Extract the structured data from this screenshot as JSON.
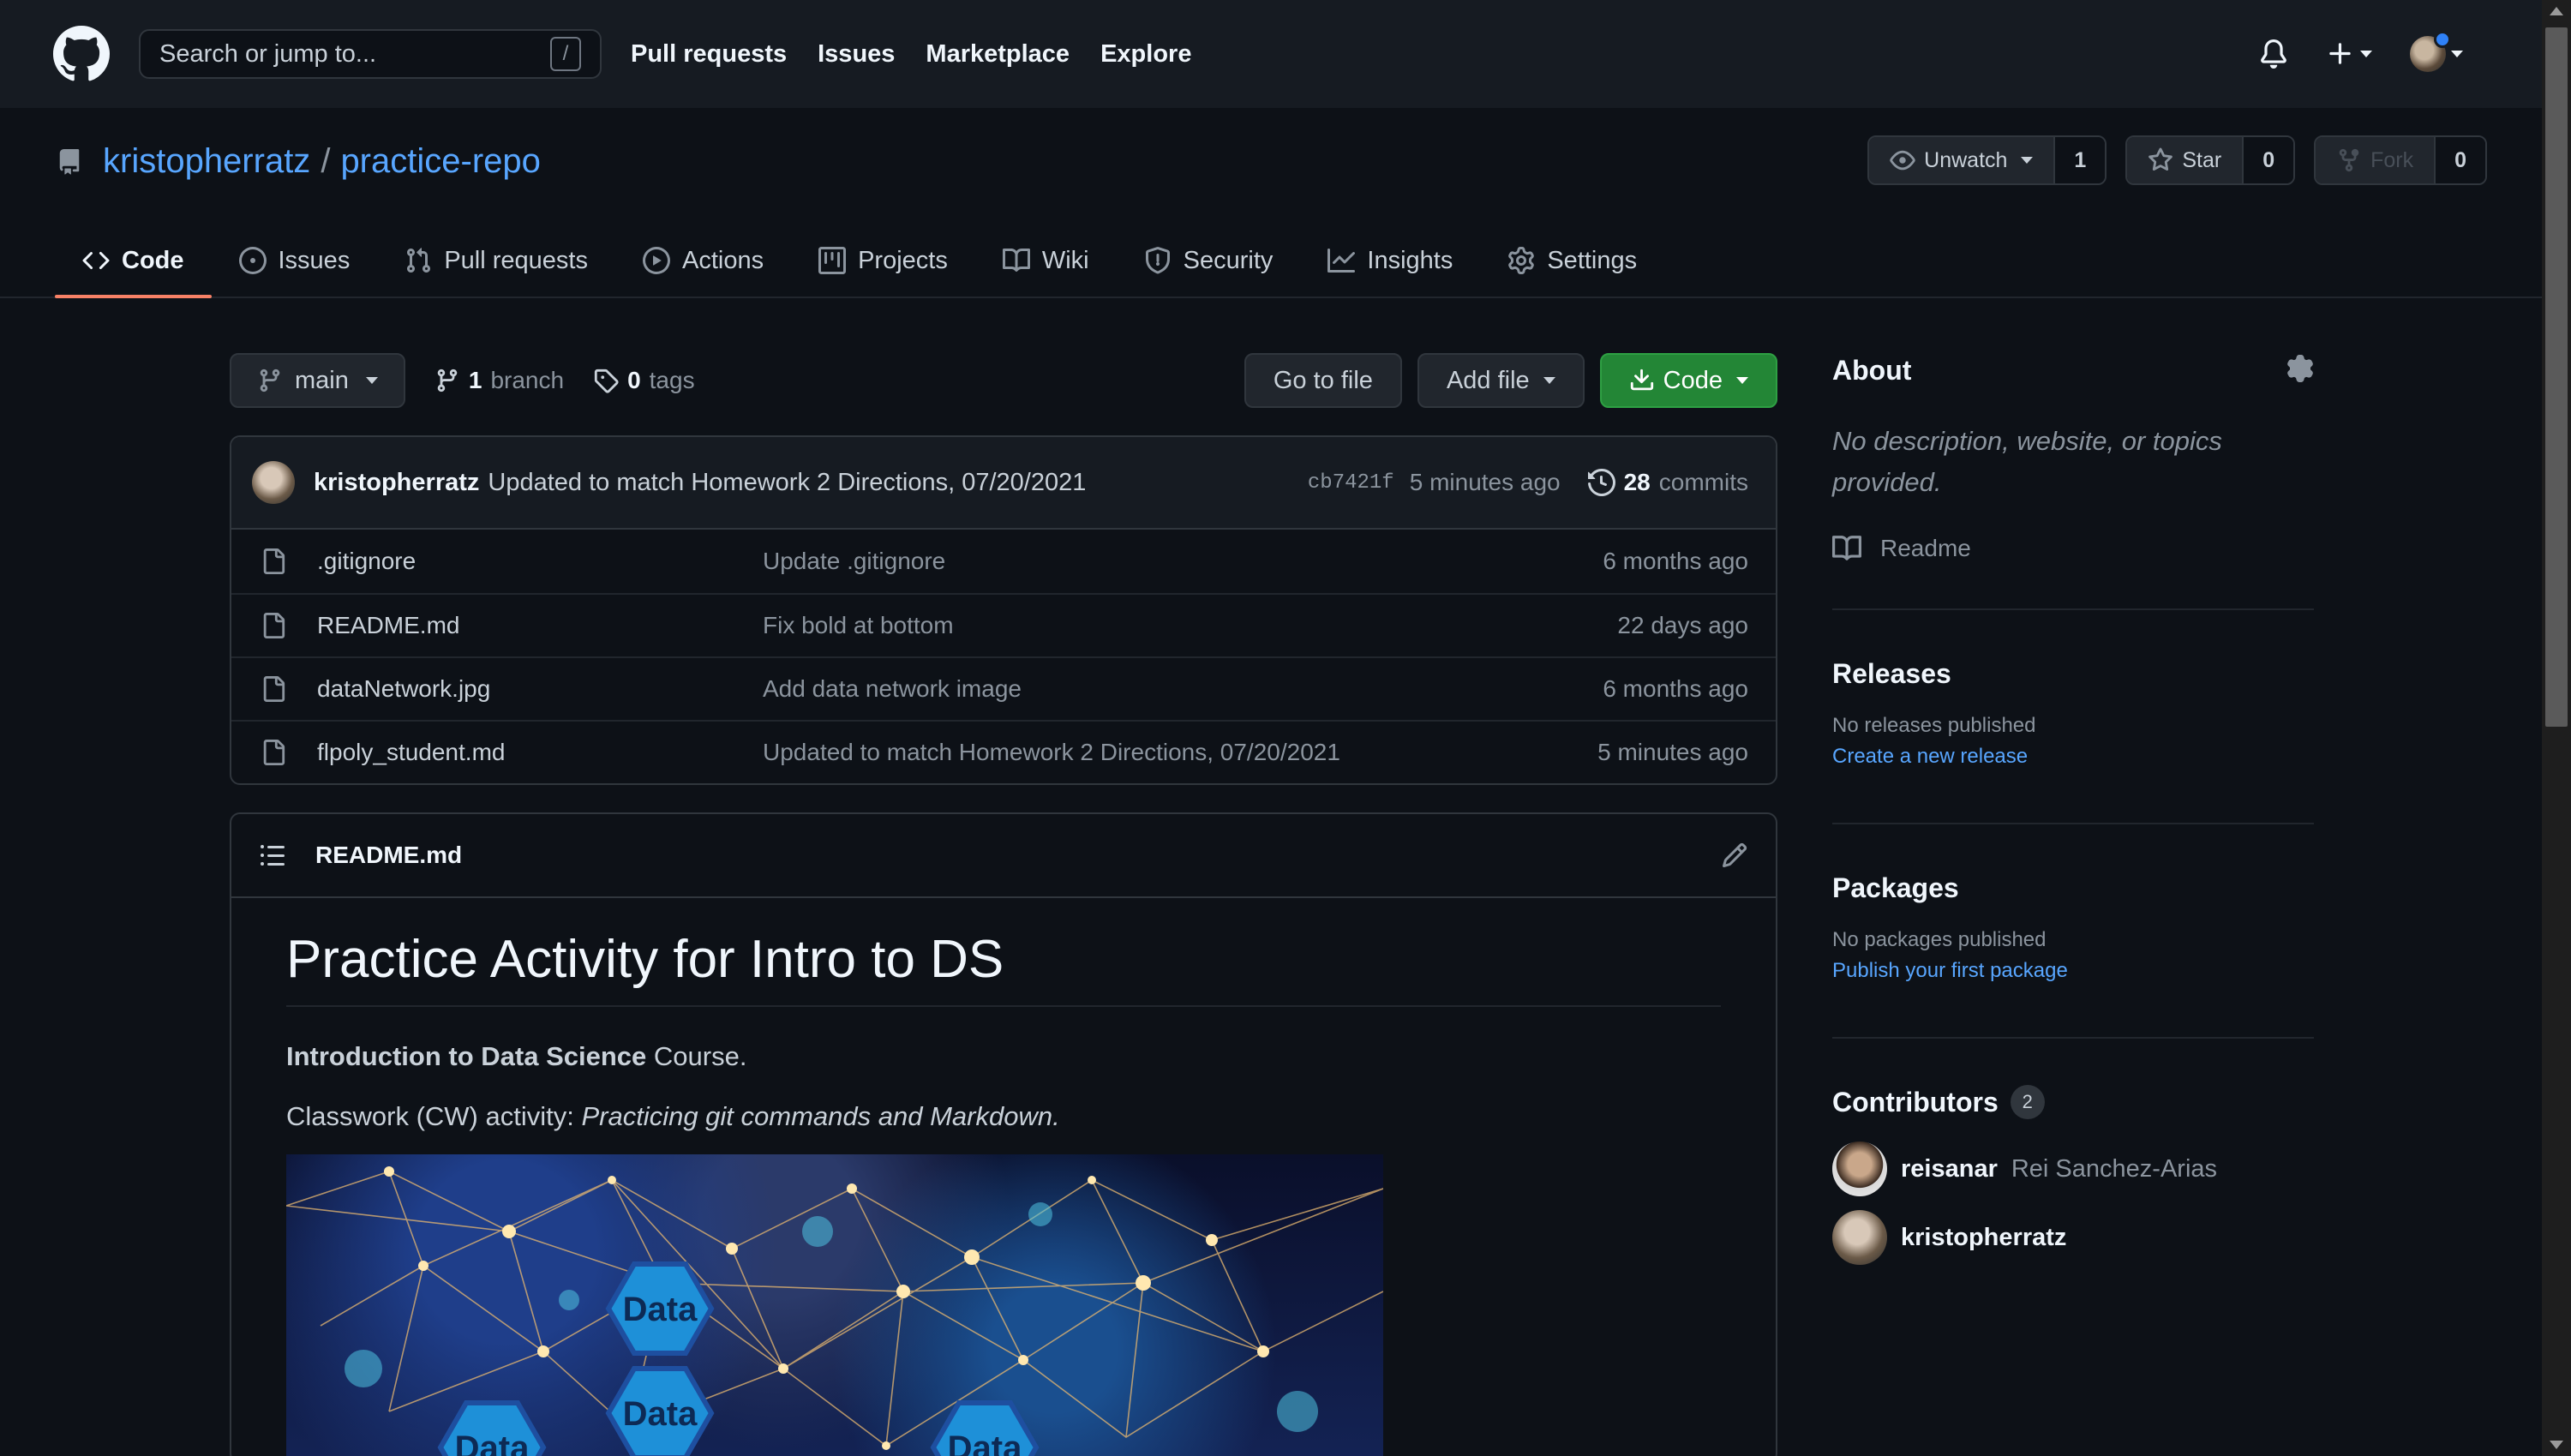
{
  "header": {
    "search_placeholder": "Search or jump to...",
    "search_shortcut": "/",
    "nav": [
      "Pull requests",
      "Issues",
      "Marketplace",
      "Explore"
    ],
    "icons": [
      "github-logo",
      "bell-icon",
      "plus-icon",
      "avatar"
    ]
  },
  "repo": {
    "owner": "kristopherratz",
    "separator": "/",
    "name": "practice-repo",
    "actions": {
      "watch_label": "Unwatch",
      "watch_count": "1",
      "star_label": "Star",
      "star_count": "0",
      "fork_label": "Fork",
      "fork_count": "0"
    },
    "tabs": [
      {
        "label": "Code",
        "icon": "code-icon",
        "active": true
      },
      {
        "label": "Issues",
        "icon": "issue-icon"
      },
      {
        "label": "Pull requests",
        "icon": "pull-request-icon"
      },
      {
        "label": "Actions",
        "icon": "play-icon"
      },
      {
        "label": "Projects",
        "icon": "project-icon"
      },
      {
        "label": "Wiki",
        "icon": "book-icon"
      },
      {
        "label": "Security",
        "icon": "shield-icon"
      },
      {
        "label": "Insights",
        "icon": "graph-icon"
      },
      {
        "label": "Settings",
        "icon": "gear-icon"
      }
    ]
  },
  "file_nav": {
    "branch": "main",
    "branch_count": "1",
    "branch_label": "branch",
    "tag_count": "0",
    "tag_label": "tags",
    "go_to_file": "Go to file",
    "add_file": "Add file",
    "code": "Code"
  },
  "commit": {
    "author": "kristopherratz",
    "message": "Updated to match Homework 2 Directions, 07/20/2021",
    "sha": "cb7421f",
    "ago": "5 minutes ago",
    "count": "28",
    "count_label": "commits"
  },
  "files": [
    {
      "name": ".gitignore",
      "message": "Update .gitignore",
      "age": "6 months ago"
    },
    {
      "name": "README.md",
      "message": "Fix bold at bottom",
      "age": "22 days ago"
    },
    {
      "name": "dataNetwork.jpg",
      "message": "Add data network image",
      "age": "6 months ago"
    },
    {
      "name": "flpoly_student.md",
      "message": "Updated to match Homework 2 Directions, 07/20/2021",
      "age": "5 minutes ago"
    }
  ],
  "readme": {
    "filename": "README.md",
    "h1": "Practice Activity for Intro to DS",
    "p1_bold": "Introduction to Data Science",
    "p1_rest": " Course.",
    "p2_prefix": "Classwork (CW) activity: ",
    "p2_em": "Practicing git commands and Markdown.",
    "image_labels": [
      "Data",
      "Data",
      "Data",
      "Data"
    ]
  },
  "sidebar": {
    "about_title": "About",
    "about_desc": "No description, website, or topics provided.",
    "readme_link": "Readme",
    "releases_title": "Releases",
    "releases_empty": "No releases published",
    "releases_link": "Create a new release",
    "packages_title": "Packages",
    "packages_empty": "No packages published",
    "packages_link": "Publish your first package",
    "contributors_title": "Contributors",
    "contributors_count": "2",
    "contributors": [
      {
        "login": "reisanar",
        "name": "Rei Sanchez-Arias"
      },
      {
        "login": "kristopherratz",
        "name": ""
      }
    ]
  },
  "colors": {
    "bg": "#0d1117",
    "header_bg": "#161b22",
    "link": "#58a6ff",
    "green_button": "#238636",
    "active_tab_underline": "#f78166",
    "notification_dot": "#2f81f7"
  }
}
